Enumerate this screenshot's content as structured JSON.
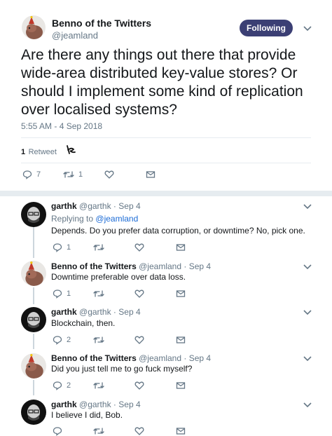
{
  "main_tweet": {
    "author_name": "Benno of the Twitters",
    "author_handle": "@jeamland",
    "follow_button": "Following",
    "text": "Are there any things out there that provide wide-area distributed key-value stores? Or should I implement some kind of replication over localised systems?",
    "timestamp": "5:55 AM - 4 Sep 2018",
    "retweet_count": "1",
    "retweet_label": "Retweet",
    "actions": {
      "replies": "7",
      "retweets": "1",
      "likes": ""
    }
  },
  "replies": [
    {
      "name": "garthk",
      "handle": "@garthk",
      "date": "Sep 4",
      "replying_to_prefix": "Replying to",
      "replying_to_handle": "@jeamland",
      "text": "Depends. Do you prefer data corruption, or downtime? No, pick one.",
      "reply_count": "1",
      "retweet_count": "",
      "like_count": ""
    },
    {
      "name": "Benno of the Twitters",
      "handle": "@jeamland",
      "date": "Sep 4",
      "text": "Downtime preferable over data loss.",
      "reply_count": "1",
      "retweet_count": "",
      "like_count": ""
    },
    {
      "name": "garthk",
      "handle": "@garthk",
      "date": "Sep 4",
      "text": "Blockchain, then.",
      "reply_count": "2",
      "retweet_count": "",
      "like_count": ""
    },
    {
      "name": "Benno of the Twitters",
      "handle": "@jeamland",
      "date": "Sep 4",
      "text": "Did you just tell me to go fuck myself?",
      "reply_count": "2",
      "retweet_count": "",
      "like_count": ""
    },
    {
      "name": "garthk",
      "handle": "@garthk",
      "date": "Sep 4",
      "text": "I believe I did, Bob.",
      "reply_count": "",
      "retweet_count": "",
      "like_count": ""
    }
  ],
  "colors": {
    "follow_button_bg": "#3b3f74",
    "text_primary": "#14171a",
    "text_secondary": "#657786",
    "link": "#1b6bd6",
    "divider": "#e6ecf0"
  },
  "icons": [
    "reply-icon",
    "retweet-icon",
    "like-icon",
    "message-icon",
    "chevron-down-icon"
  ]
}
